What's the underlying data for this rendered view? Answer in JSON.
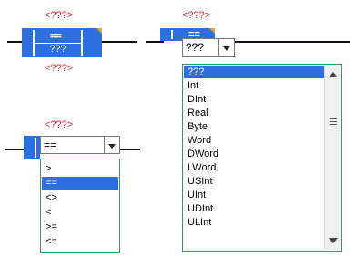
{
  "block1": {
    "top_placeholder": "<???>",
    "operator": "==",
    "operand": "???",
    "bottom_placeholder": "<???>"
  },
  "block2": {
    "top_placeholder": "<???>",
    "operator": "==",
    "combo_value": "???",
    "list_items": [
      "???",
      "Int",
      "DInt",
      "Real",
      "Byte",
      "Word",
      "DWord",
      "LWord",
      "USInt",
      "UInt",
      "UDInt",
      "ULInt"
    ],
    "selected_index": 0
  },
  "block3": {
    "top_placeholder": "<???>",
    "combo_value": "==",
    "list_items": [
      ">",
      "==",
      "<>",
      "<",
      ">=",
      "<="
    ],
    "selected_index": 1
  },
  "colors": {
    "accent": "#2d6fe0",
    "placeholder": "#e8253a",
    "list_border": "#2aa14a",
    "corner": "#e8a23a"
  },
  "icons": [
    "dropdown-arrow-icon",
    "scroll-up-icon",
    "scroll-down-icon",
    "scroll-grip-icon"
  ]
}
